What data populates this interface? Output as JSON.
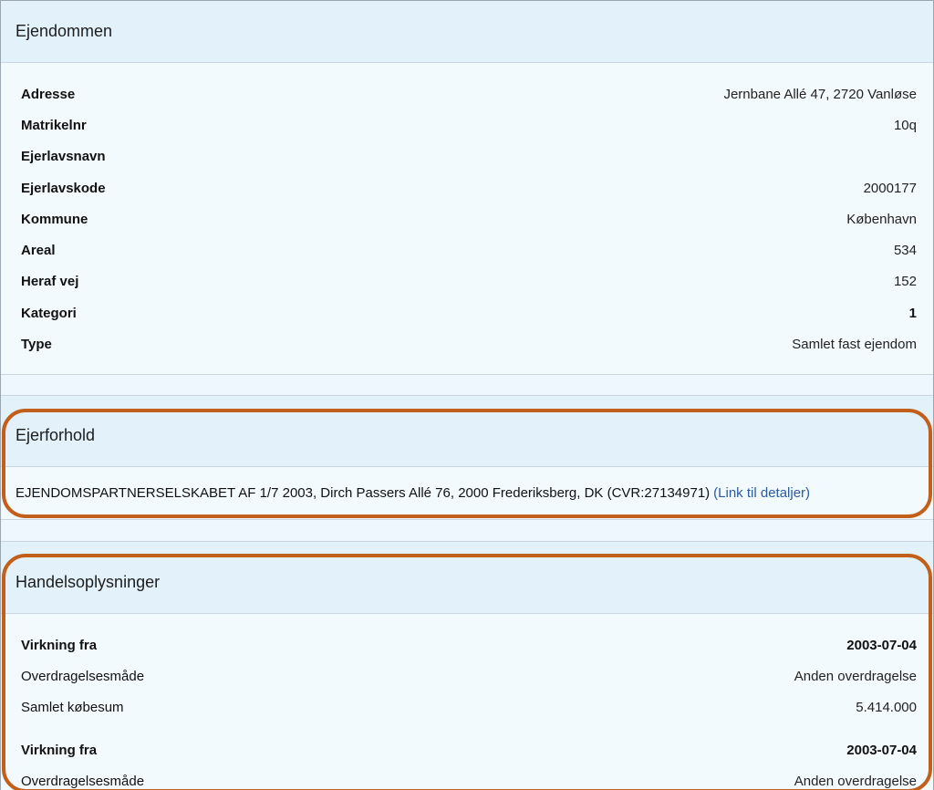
{
  "ejendommen": {
    "title": "Ejendommen",
    "rows": [
      {
        "label": "Adresse",
        "value": "Jernbane Allé 47, 2720 Vanløse"
      },
      {
        "label": "Matrikelnr",
        "value": "10q"
      },
      {
        "label": "Ejerlavsnavn",
        "value": ""
      },
      {
        "label": "Ejerlavskode",
        "value": "2000177"
      },
      {
        "label": "Kommune",
        "value": "København"
      },
      {
        "label": "Areal",
        "value": "534"
      },
      {
        "label": "Heraf vej",
        "value": "152"
      },
      {
        "label": "Kategori",
        "value": "1"
      },
      {
        "label": "Type",
        "value": "Samlet fast ejendom"
      }
    ]
  },
  "ejerforhold": {
    "title": "Ejerforhold",
    "owner_text": "EJENDOMSPARTNERSELSKABET AF 1/7 2003, Dirch Passers Allé 76, 2000 Frederiksberg, DK (CVR:27134971)",
    "link_label": "(Link til detaljer)"
  },
  "handel": {
    "title": "Handelsoplysninger",
    "groups": [
      {
        "virkning_label": "Virkning fra",
        "virkning_value": "2003-07-04",
        "overdragelse_label": "Overdragelsesmåde",
        "overdragelse_value": "Anden overdragelse",
        "kobesum_label": "Samlet købesum",
        "kobesum_value": "5.414.000"
      },
      {
        "virkning_label": "Virkning fra",
        "virkning_value": "2003-07-04",
        "overdragelse_label": "Overdragelsesmåde",
        "overdragelse_value": "Anden overdragelse"
      }
    ]
  },
  "colors": {
    "highlight": "#c2601b",
    "link": "#2a5aa0",
    "header_bg": "#e3f1fb"
  }
}
